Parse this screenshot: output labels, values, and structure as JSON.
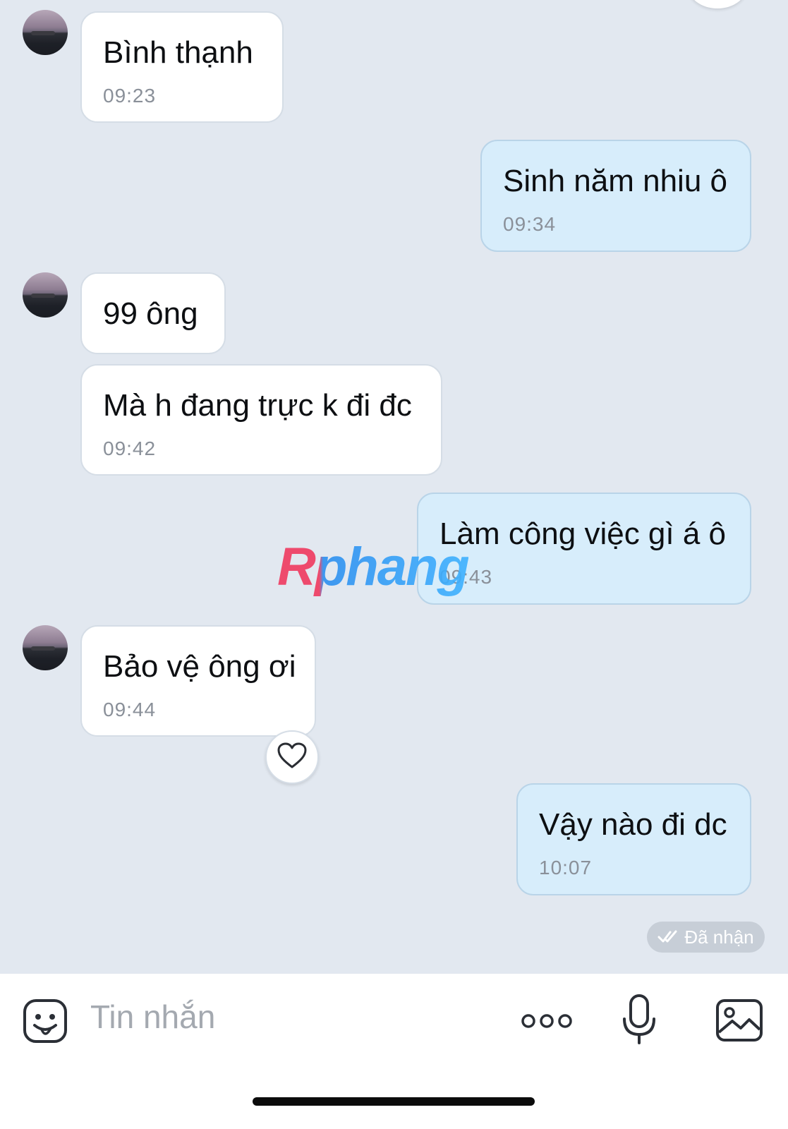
{
  "messages": [
    {
      "sender": "contact",
      "text": "Bình thạnh",
      "time": "09:23"
    },
    {
      "sender": "me",
      "text": "Sinh năm nhiu ô",
      "time": "09:34"
    },
    {
      "sender": "contact",
      "text": "99 ông",
      "time": ""
    },
    {
      "sender": "contact",
      "text": "Mà h đang trực k đi đc",
      "time": "09:42"
    },
    {
      "sender": "me",
      "text": "Làm công việc gì á ô",
      "time": "09:43"
    },
    {
      "sender": "contact",
      "text": "Bảo vệ ông ơi",
      "time": "09:44"
    },
    {
      "sender": "me",
      "text": "Vậy nào đi dc",
      "time": "10:07"
    }
  ],
  "reaction": {
    "icon": "heart-outline-icon"
  },
  "status": {
    "label": "Đã nhận",
    "icon": "double-check-icon"
  },
  "watermark": {
    "text": "Rphang"
  },
  "composer": {
    "placeholder": "Tin nhắn",
    "icons": [
      "emoji-icon",
      "more-icon",
      "microphone-icon",
      "image-icon"
    ]
  },
  "colors": {
    "chat_background": "#e2e8f0",
    "incoming_bubble": "#ffffff",
    "outgoing_bubble": "#d7edfb",
    "time_text": "#8a9099"
  }
}
